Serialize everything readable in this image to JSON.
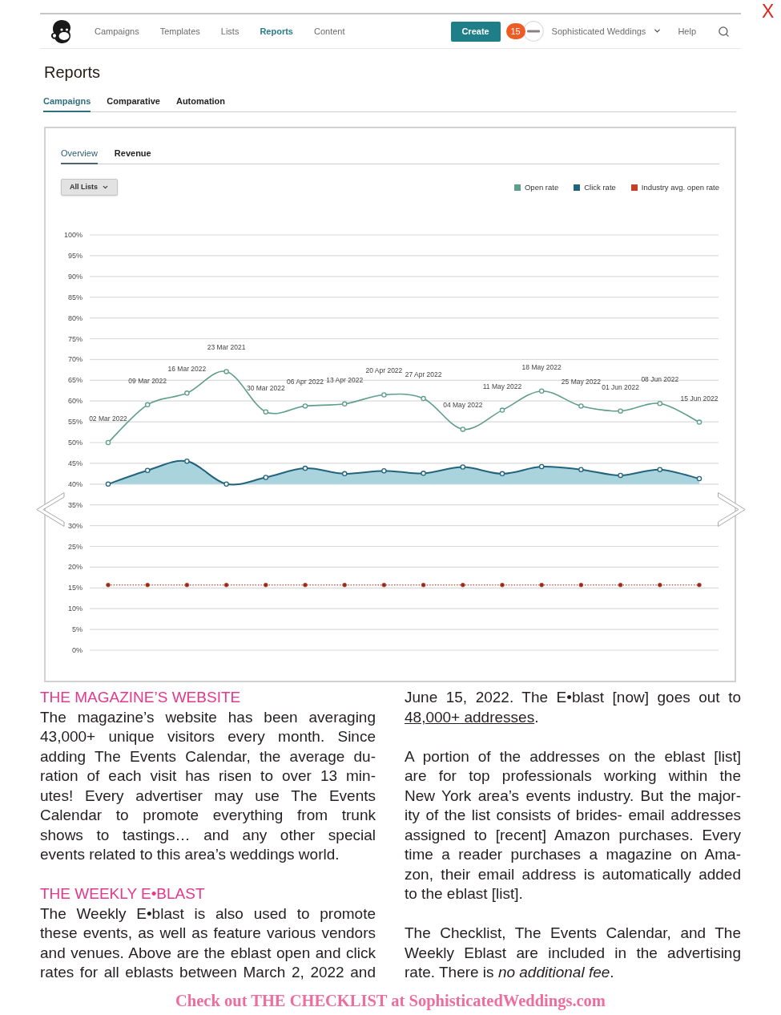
{
  "close_button": "X",
  "app": {
    "nav": {
      "items": [
        {
          "label": "Campaigns",
          "selected": false
        },
        {
          "label": "Templates",
          "selected": false
        },
        {
          "label": "Lists",
          "selected": false
        },
        {
          "label": "Reports",
          "selected": true
        },
        {
          "label": "Content",
          "selected": false
        }
      ],
      "create_button": "Create",
      "notification_count": "15",
      "account_name": "Sophisticated Weddings",
      "help": "Help"
    },
    "page_title": "Reports",
    "tabs": [
      {
        "label": "Campaigns",
        "selected": true
      },
      {
        "label": "Comparative",
        "selected": false
      },
      {
        "label": "Automation",
        "selected": false
      }
    ],
    "report_card": {
      "tabs": [
        {
          "label": "Overview",
          "selected": true
        },
        {
          "label": "Revenue",
          "selected": false
        }
      ],
      "list_filter": "All Lists",
      "chart_data": {
        "type": "line",
        "grid": true,
        "categories": [
          "02 Mar 2022",
          "09 Mar 2022",
          "16 Mar 2022",
          "23 Mar 2021",
          "30 Mar 2022",
          "06 Apr 2022",
          "13 Apr 2022",
          "20 Apr 2022",
          "27 Apr 2022",
          "04 May 2022",
          "11 May 2022",
          "18 May 2022",
          "25 May 2022",
          "01 Jun 2022",
          "08 Jun 2022",
          "15 Jun 2022"
        ],
        "series": [
          {
            "name": "Open rate",
            "type": "line",
            "color": "#5f9e8c",
            "marker": "circle",
            "line_style": "solid",
            "values": [
              50.0,
              59.1,
              61.9,
              67.1,
              57.4,
              58.8,
              59.3,
              61.5,
              60.6,
              53.2,
              57.8,
              62.4,
              58.8,
              57.6,
              59.4,
              54.9
            ]
          },
          {
            "name": "Click rate",
            "type": "area",
            "color": "#23647c",
            "marker": "circle",
            "line_style": "solid",
            "values": [
              40.0,
              43.3,
              45.5,
              40.0,
              41.6,
              43.8,
              42.5,
              43.2,
              42.6,
              44.1,
              42.5,
              44.2,
              43.5,
              42.1,
              43.5,
              41.3
            ]
          },
          {
            "name": "Industry avg. open rate",
            "type": "line",
            "color": "#c2412b",
            "marker": "circle",
            "line_style": "dotted",
            "values": [
              15.7,
              15.7,
              15.7,
              15.7,
              15.7,
              15.7,
              15.7,
              15.7,
              15.7,
              15.7,
              15.7,
              15.7,
              15.7,
              15.7,
              15.7,
              15.7
            ]
          }
        ],
        "ylim": [
          0,
          100
        ],
        "yticks": [
          {
            "value": 0,
            "label": "0%"
          },
          {
            "value": 5,
            "label": "5%"
          },
          {
            "value": 10,
            "label": "10%"
          },
          {
            "value": 15,
            "label": "15%"
          },
          {
            "value": 20,
            "label": "20%"
          },
          {
            "value": 25,
            "label": "25%"
          },
          {
            "value": 30,
            "label": "30%"
          },
          {
            "value": 35,
            "label": "35%"
          },
          {
            "value": 40,
            "label": "40%"
          },
          {
            "value": 45,
            "label": "45%"
          },
          {
            "value": 50,
            "label": "50%"
          },
          {
            "value": 55,
            "label": "55%"
          },
          {
            "value": 60,
            "label": "60%"
          },
          {
            "value": 65,
            "label": "65%"
          },
          {
            "value": 70,
            "label": "70%"
          },
          {
            "value": 75,
            "label": "75%"
          },
          {
            "value": 80,
            "label": "80%"
          },
          {
            "value": 85,
            "label": "85%"
          },
          {
            "value": 90,
            "label": "90%"
          },
          {
            "value": 95,
            "label": "95%"
          },
          {
            "value": 100,
            "label": "100%"
          }
        ]
      }
    }
  },
  "article": {
    "left": [
      {
        "kind": "heading",
        "text": "THE MAGAZINE’S WEBSITE"
      },
      {
        "kind": "paragraph",
        "continued": false,
        "lines": [
          "The magazine’s website has been averaging",
          "43,000+ unique visitors every month. Since",
          "adding The Events Calendar, the average du-",
          "ration of each visit has risen to over 13 min-",
          "utes! Every advertiser may use The Events",
          "Calendar to promote everything from trunk",
          "shows to tastings… and any other special",
          "events related to this area’s weddings world."
        ]
      },
      {
        "kind": "heading",
        "text": "THE WEEKLY E•BLAST"
      },
      {
        "kind": "paragraph",
        "continued": true,
        "lines": [
          "The Weekly E•blast is also used to promote",
          "these events, as well as feature various vendors",
          "and venues. Above are the eblast open and click",
          "rates for all eblasts between March 2, 2022 and"
        ]
      }
    ],
    "right": [
      {
        "kind": "paragraph",
        "continued": false,
        "lines": [
          "June 15, 2022. The E•blast [now] goes out to"
        ],
        "link": "48,000+ addresses",
        "link_tail": "."
      },
      {
        "kind": "paragraph",
        "continued": false,
        "lines": [
          "A portion of the addresses on the eblast [list]",
          "are for top professionals working within the",
          "New York area’s events industry. But the major-",
          "ity of the list consists of brides- email addresses",
          "assigned to [recent] Amazon purchases. Every",
          "time a reader purchases a magazine on Ama-",
          "zon, their email address is automatically added",
          "to the eblast [list]."
        ]
      },
      {
        "kind": "paragraph",
        "continued": false,
        "lines": [
          "The Checklist, The Events Calendar, and The",
          "Weekly Eblast are included in the advertising",
          "rate. There is *no additional fee*."
        ]
      }
    ]
  },
  "footer": "Check out THE CHECKLIST at SophisticatedWeddings.com"
}
